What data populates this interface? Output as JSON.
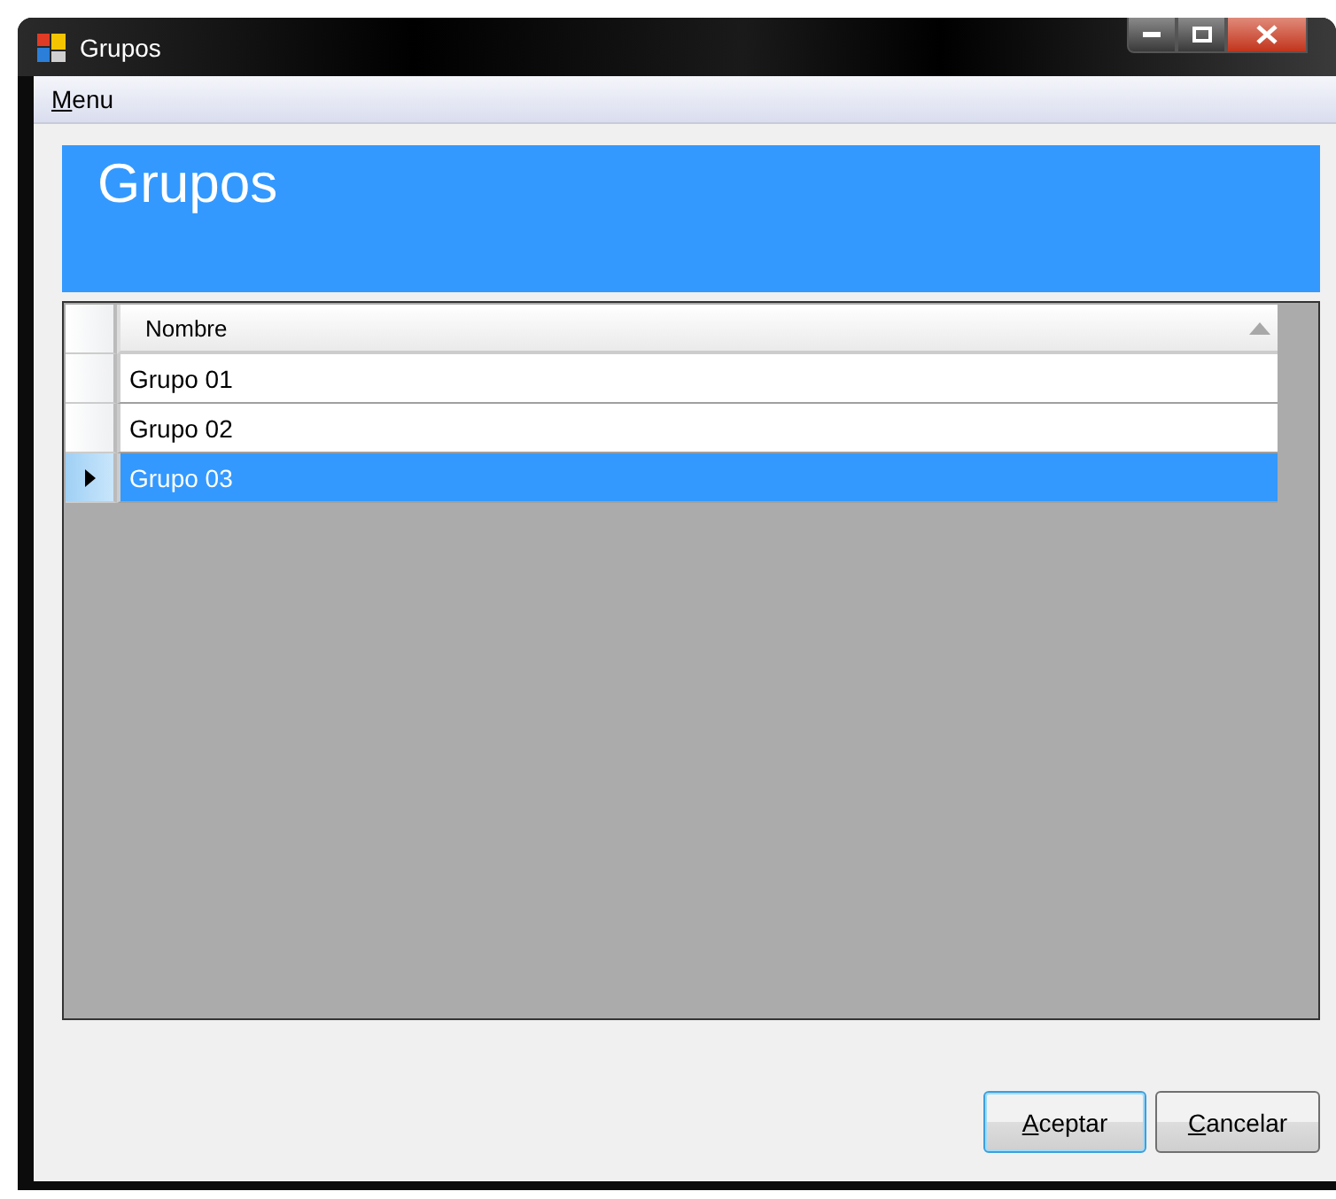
{
  "window": {
    "title": "Grupos"
  },
  "menu": [
    {
      "label": "Menu"
    }
  ],
  "header": {
    "title": "Grupos"
  },
  "table": {
    "columns": [
      {
        "label": "Nombre",
        "sorted_ascending": true
      }
    ],
    "rows": [
      {
        "cells": [
          "Grupo 01"
        ],
        "selected": false
      },
      {
        "cells": [
          "Grupo 02"
        ],
        "selected": false
      },
      {
        "cells": [
          "Grupo 03"
        ],
        "selected": true
      }
    ]
  },
  "buttons": [
    {
      "label": "Aceptar",
      "default": true
    },
    {
      "label": "Cancelar",
      "default": false
    }
  ]
}
